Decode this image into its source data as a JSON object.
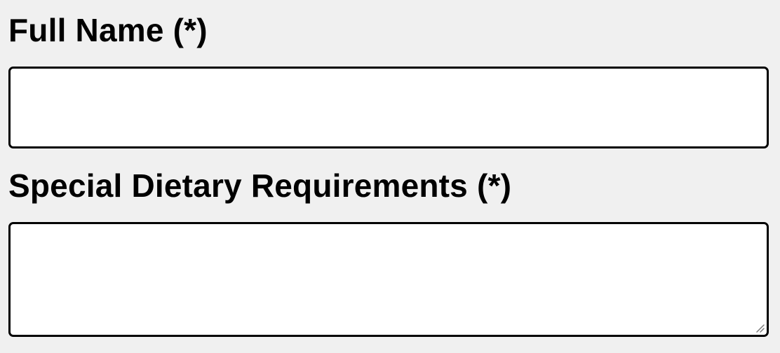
{
  "form": {
    "full_name": {
      "label": "Full Name (*)",
      "value": "",
      "placeholder": ""
    },
    "dietary": {
      "label": "Special Dietary Requirements (*)",
      "value": "",
      "placeholder": ""
    }
  },
  "icons": {
    "resize_handle": "resize-handle-icon"
  },
  "colors": {
    "background": "#f0f0f0",
    "field_background": "#ffffff",
    "border": "#000000",
    "text": "#000000"
  }
}
